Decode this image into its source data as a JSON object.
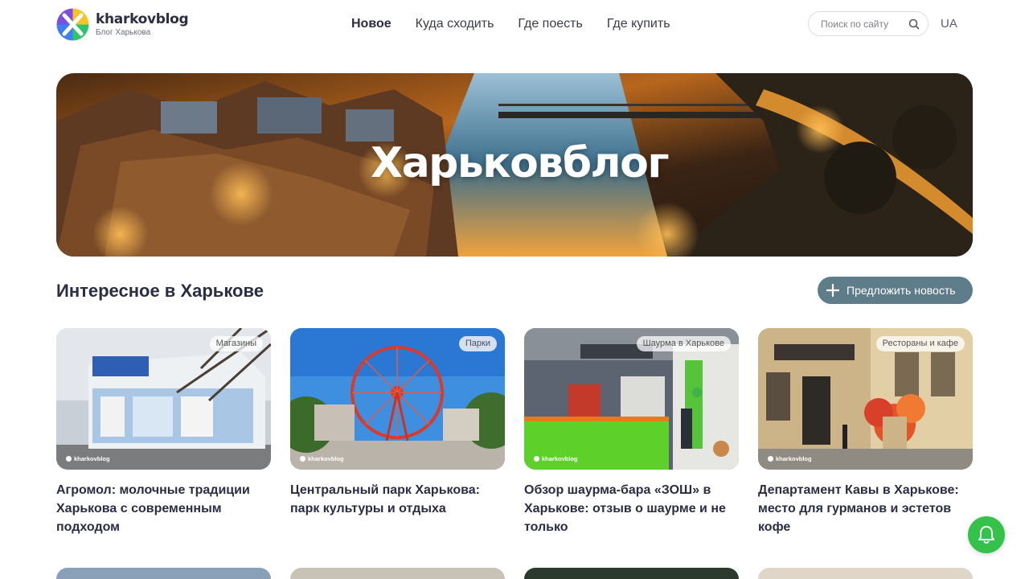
{
  "header": {
    "logo_name": "kharkovblog",
    "logo_sub": "Блог Харькова",
    "nav": [
      {
        "label": "Новое",
        "active": true
      },
      {
        "label": "Куда сходить",
        "active": false
      },
      {
        "label": "Где поесть",
        "active": false
      },
      {
        "label": "Где купить",
        "active": false
      }
    ],
    "search_placeholder": "Поиск по сайту",
    "lang": "UA"
  },
  "hero": {
    "title": "Харьковблог"
  },
  "section": {
    "title": "Интересное в Харькове",
    "suggest_button": "Предложить новость"
  },
  "cards": [
    {
      "tag": "Магазины",
      "title": "Агромол: молочные традиции Харькова с современным подходом",
      "watermark": "kharkovblog"
    },
    {
      "tag": "Парки",
      "title": "Центральный парк Харькова: парк культуры и отдыха",
      "watermark": "kharkovblog"
    },
    {
      "tag": "Шаурма в Харькове",
      "title": "Обзор шаурма-бара «ЗОШ» в Харькове: отзыв о шаурме и не только",
      "watermark": "kharkovblog"
    },
    {
      "tag": "Рестораны и кафе",
      "title": "Департамент Кавы в Харькове: место для гурманов и эстетов кофе",
      "watermark": "kharkovblog"
    }
  ],
  "colors": {
    "accent_button": "#5f7c8a",
    "bell": "#35c24a",
    "text_dark": "#2b2d42"
  }
}
